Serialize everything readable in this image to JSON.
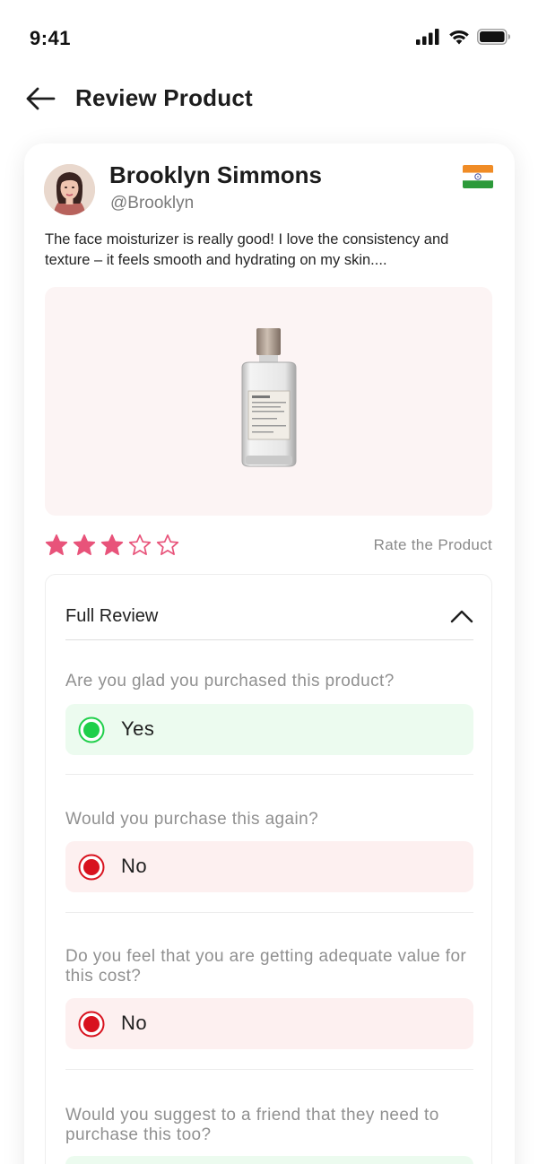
{
  "status_bar": {
    "time": "9:41",
    "icons": [
      "signal-icon",
      "wifi-icon",
      "battery-icon"
    ]
  },
  "header": {
    "back_icon": "arrow-left-icon",
    "title": "Review Product"
  },
  "review": {
    "reviewer_name": "Brooklyn Simmons",
    "reviewer_handle": "@Brooklyn",
    "country_flag": "india-flag",
    "text": "The face moisturizer is really good! I love the consistency and texture – it feels smooth and hydrating on my skin....",
    "product_image": "perfume-bottle",
    "rating": 3,
    "rating_max": 5,
    "rate_label": "Rate the Product"
  },
  "full_review": {
    "title": "Full Review",
    "expanded": true,
    "questions": [
      {
        "question": "Are you glad you purchased this product?",
        "answer": "Yes",
        "status": "positive"
      },
      {
        "question": "Would you purchase this again?",
        "answer": "No",
        "status": "negative"
      },
      {
        "question": "Do you feel that you are getting adequate value for this cost?",
        "answer": "No",
        "status": "negative"
      },
      {
        "question": "Would you suggest to a friend that they need to purchase this too?",
        "answer": "",
        "status": "positive"
      }
    ]
  },
  "colors": {
    "star": "#e8537a",
    "positive": "#1fcf4a",
    "positive_bg": "#ecfbef",
    "negative": "#d8121e",
    "negative_bg": "#fdf0f0",
    "image_bg": "#fcf4f4"
  }
}
